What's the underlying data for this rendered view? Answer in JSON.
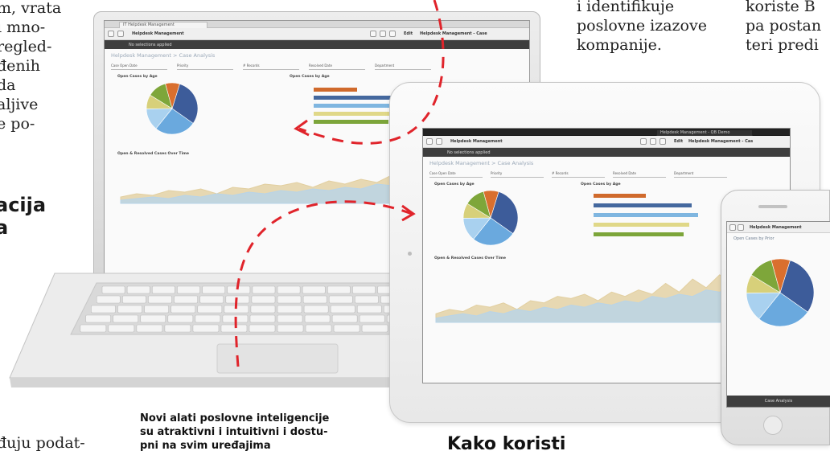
{
  "article": {
    "col1_lines": [
      "m, vrata",
      "i mno-",
      "regled-",
      "đenih",
      "da",
      "aljive",
      "e po-"
    ],
    "col1_heading_lines": [
      "acija",
      "a"
    ],
    "col1_bottom": "đuju podat-",
    "col2_lines": [
      "i identifikuje",
      "poslovne izazove",
      "kompanije."
    ],
    "col3_lines": [
      "koriste B",
      "pa postan",
      "teri predi"
    ],
    "caption_lines": [
      "Novi alati poslovne inteligencije",
      "su atraktivni i intuitivni i dostu-",
      "pni na svim uređajima"
    ],
    "bottom_heading": "Kako koristi"
  },
  "dashboard": {
    "tab": "IT Helpdesk Management",
    "app_title": "Helpdesk Management",
    "selection": "No selections applied",
    "sheet_title": "Helpdesk Management > Case Analysis",
    "filters": [
      "Case Open Date",
      "Priority",
      "# Records",
      "Resolved Date",
      "Department"
    ],
    "actions": {
      "edit": "Edit",
      "sheet": "Helpdesk Management - Case"
    },
    "pie_title": "Open Cases by Age",
    "bar_title": "Open Cases by Age",
    "line_title": "Open & Resolved Cases Over Time",
    "phone_title": "Helpdesk Management",
    "phone_sheet": "Open Cases by Prior",
    "phone_footer": "Case Analysis",
    "tablet_status": "Helpdesk Management - QB Demo"
  },
  "chart_data": [
    {
      "type": "pie",
      "slices": [
        {
          "label": "",
          "value": 30,
          "color": "#3d5c9a"
        },
        {
          "label": "",
          "value": 26,
          "color": "#6aa9de"
        },
        {
          "label": "",
          "value": 14,
          "color": "#a9d1ef"
        },
        {
          "label": "",
          "value": 9,
          "color": "#d7d07a"
        },
        {
          "label": "",
          "value": 12,
          "color": "#7ea63a"
        },
        {
          "label": "",
          "value": 9,
          "color": "#d96f2e"
        }
      ]
    },
    {
      "type": "bar",
      "orientation": "horizontal",
      "values": [
        18,
        34,
        36,
        33,
        31
      ],
      "colors": [
        "#d06a2c",
        "#44689e",
        "#7fb6e0",
        "#e0d888",
        "#7ca53a"
      ]
    },
    {
      "type": "area",
      "series": [
        {
          "values": [
            4,
            6,
            5,
            8,
            7,
            9,
            6,
            10,
            9,
            12,
            11,
            13,
            10,
            14,
            12,
            15,
            13,
            18,
            14,
            20,
            16,
            22,
            17,
            24,
            21,
            26
          ],
          "color": "#e2cfa0"
        },
        {
          "values": [
            2,
            3,
            4,
            3,
            5,
            4,
            6,
            5,
            7,
            6,
            8,
            7,
            9,
            8,
            10,
            9,
            12,
            11,
            13,
            12,
            15,
            14,
            17,
            16,
            19,
            20
          ],
          "color": "#b8d4e8"
        }
      ]
    }
  ],
  "colors": {
    "arrow": "#e0242b",
    "text": "#1f1f1f"
  }
}
